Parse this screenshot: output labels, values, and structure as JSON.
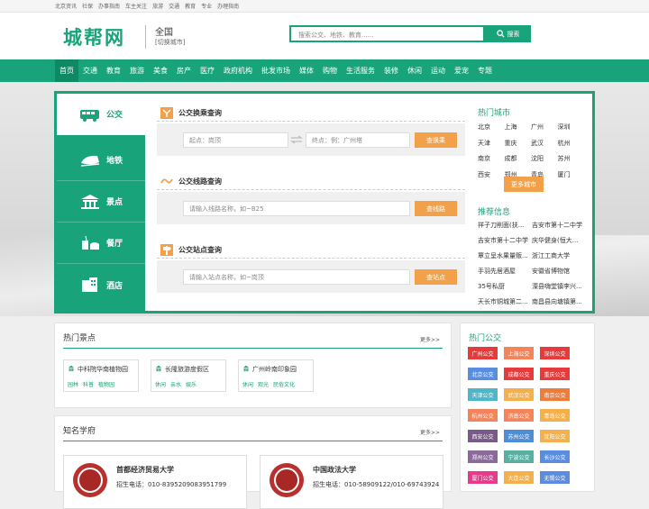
{
  "topbar": {
    "links": [
      "北京资讯",
      "社保",
      "办事指南",
      "车主关注",
      "旅游",
      "交通",
      "教育",
      "专业",
      "办理指南"
    ]
  },
  "header": {
    "logo": "城帮网",
    "city": "全国",
    "city_switch": "[切换城市]",
    "search_placeholder": "搜索公交、地铁、教育......",
    "search_button": "搜索"
  },
  "nav": {
    "items": [
      "首页",
      "交通",
      "教育",
      "旅游",
      "美食",
      "房产",
      "医疗",
      "政府机构",
      "批发市场",
      "媒体",
      "购物",
      "生活服务",
      "装修",
      "休闲",
      "运动",
      "爱宠",
      "专题"
    ],
    "active": 0
  },
  "side_tabs": [
    {
      "label": "公交",
      "icon": "bus-icon"
    },
    {
      "label": "地铁",
      "icon": "subway-icon"
    },
    {
      "label": "景点",
      "icon": "temple-icon"
    },
    {
      "label": "餐厅",
      "icon": "restaurant-icon"
    },
    {
      "label": "酒店",
      "icon": "hotel-icon"
    }
  ],
  "queries": {
    "transfer": {
      "title": "公交换乘查询",
      "start_placeholder": "起点：岗顶",
      "end_placeholder": "终点：例：广州塔",
      "button": "查换乘"
    },
    "line": {
      "title": "公交线路查询",
      "placeholder": "请输入线路名称，如~B25",
      "button": "查线路"
    },
    "station": {
      "title": "公交站点查询",
      "placeholder": "请输入站点名称，如~岗顶",
      "button": "查站点"
    }
  },
  "hot_cities": {
    "title": "热门城市",
    "cities": [
      "北京",
      "上海",
      "广州",
      "深圳",
      "天津",
      "重庆",
      "武汉",
      "杭州",
      "南京",
      "成都",
      "沈阳",
      "苏州",
      "西安",
      "郑州",
      "青岛",
      "厦门"
    ],
    "more": "更多城市"
  },
  "recommend": {
    "title": "推荐信息",
    "items": [
      [
        "祥子刀削面(扶...",
        "吉安市第十二中学"
      ],
      [
        "吉安市第十二中学",
        "庆华健身(恒大..."
      ],
      [
        "覃立呈水果量贩...",
        "浙江工商大学"
      ],
      [
        "手羽先居酒屋",
        "安徽省博物馆"
      ],
      [
        "35号私厨",
        "溧县嗨堂镇李兴..."
      ],
      [
        "天长市铜城第二...",
        "南昌县向塘镇第..."
      ]
    ]
  },
  "hot_spots": {
    "title": "热门景点",
    "more": "更多>>",
    "items": [
      {
        "name": "中科院华南植物园",
        "tags": [
          "园林",
          "科普",
          "植物园"
        ]
      },
      {
        "name": "长隆旅游度假区",
        "tags": [
          "休闲",
          "亲水",
          "娱乐"
        ]
      },
      {
        "name": "广州岭南印象园",
        "tags": [
          "休闲",
          "观光",
          "民俗文化"
        ]
      }
    ]
  },
  "schools": {
    "title": "知名学府",
    "more": "更多>>",
    "items": [
      {
        "name": "首都经济贸易大学",
        "phone": "招生电话：010-8395209083951799"
      },
      {
        "name": "中国政法大学",
        "phone": "招生电话：010-58909122/010-69743924"
      }
    ]
  },
  "hot_bus": {
    "title": "热门公交",
    "items": [
      {
        "label": "广州公交",
        "color": "#e83a3a"
      },
      {
        "label": "上海公交",
        "color": "#f5845b"
      },
      {
        "label": "深圳公交",
        "color": "#e83a3a"
      },
      {
        "label": "北京公交",
        "color": "#5a8de0"
      },
      {
        "label": "成都公交",
        "color": "#e83a3a"
      },
      {
        "label": "重庆公交",
        "color": "#e83a3a"
      },
      {
        "label": "天津公交",
        "color": "#4db6c9"
      },
      {
        "label": "武汉公交",
        "color": "#f5b04b"
      },
      {
        "label": "南京公交",
        "color": "#f07c3a"
      },
      {
        "label": "杭州公交",
        "color": "#f5845b"
      },
      {
        "label": "济南公交",
        "color": "#f5845b"
      },
      {
        "label": "青岛公交",
        "color": "#f5b04b"
      },
      {
        "label": "西安公交",
        "color": "#7a5a8a"
      },
      {
        "label": "苏州公交",
        "color": "#4d8ed9"
      },
      {
        "label": "沈阳公交",
        "color": "#f5b04b"
      },
      {
        "label": "郑州公交",
        "color": "#8a6a9a"
      },
      {
        "label": "宁波公交",
        "color": "#5ab0a0"
      },
      {
        "label": "长沙公交",
        "color": "#5a8de0"
      },
      {
        "label": "厦门公交",
        "color": "#e83a8a"
      },
      {
        "label": "大连公交",
        "color": "#f5b04b"
      },
      {
        "label": "无锡公交",
        "color": "#5a8de0"
      }
    ]
  },
  "colors": {
    "primary": "#19a37a",
    "orange": "#f3a04a"
  }
}
